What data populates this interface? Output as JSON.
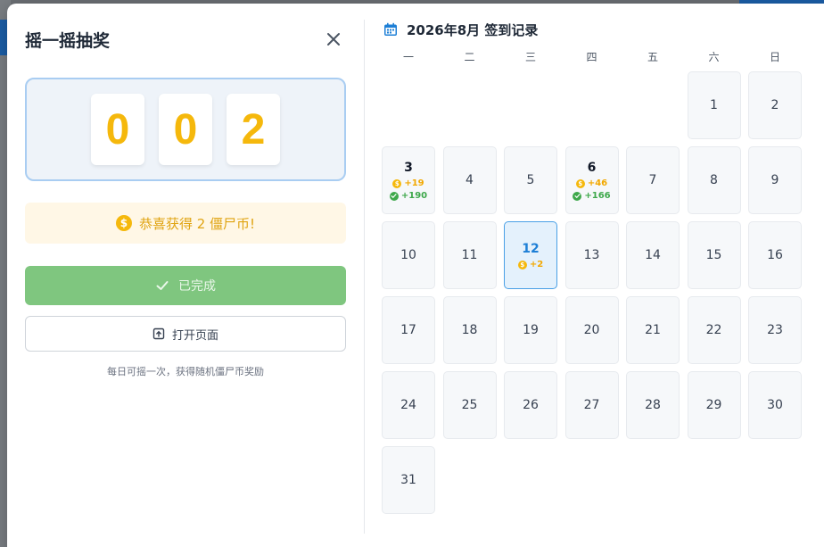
{
  "modal": {
    "title": "摇一摇抽奖",
    "digits": [
      "0",
      "0",
      "2"
    ],
    "congrats_text": "恭喜获得 2 僵尸币!",
    "done_button": "已完成",
    "open_button": "打开页面",
    "hint": "每日可摇一次，获得随机僵尸币奖励"
  },
  "calendar": {
    "title": "2026年8月 签到记录",
    "weekdays": [
      "一",
      "二",
      "三",
      "四",
      "五",
      "六",
      "日"
    ],
    "leading_blanks": 5,
    "days": [
      {
        "day": "1"
      },
      {
        "day": "2"
      },
      {
        "day": "3",
        "coin": "+19",
        "bonus": "+190"
      },
      {
        "day": "4"
      },
      {
        "day": "5"
      },
      {
        "day": "6",
        "coin": "+46",
        "bonus": "+166"
      },
      {
        "day": "7"
      },
      {
        "day": "8"
      },
      {
        "day": "9"
      },
      {
        "day": "10"
      },
      {
        "day": "11"
      },
      {
        "day": "12",
        "coin": "+2",
        "today": true
      },
      {
        "day": "13"
      },
      {
        "day": "14"
      },
      {
        "day": "15"
      },
      {
        "day": "16"
      },
      {
        "day": "17"
      },
      {
        "day": "18"
      },
      {
        "day": "19"
      },
      {
        "day": "20"
      },
      {
        "day": "21"
      },
      {
        "day": "22"
      },
      {
        "day": "23"
      },
      {
        "day": "24"
      },
      {
        "day": "25"
      },
      {
        "day": "26"
      },
      {
        "day": "27"
      },
      {
        "day": "28"
      },
      {
        "day": "29"
      },
      {
        "day": "30"
      },
      {
        "day": "31"
      }
    ]
  },
  "colors": {
    "accent_blue": "#1d7fd6",
    "coin_gold": "#f5b80c",
    "success_green": "#7fc67f",
    "bonus_green": "#3ea84b"
  },
  "icons": {
    "close": "close-icon",
    "coin": "coin-icon",
    "check": "check-icon",
    "open_page": "open-page-icon",
    "calendar": "calendar-icon"
  }
}
